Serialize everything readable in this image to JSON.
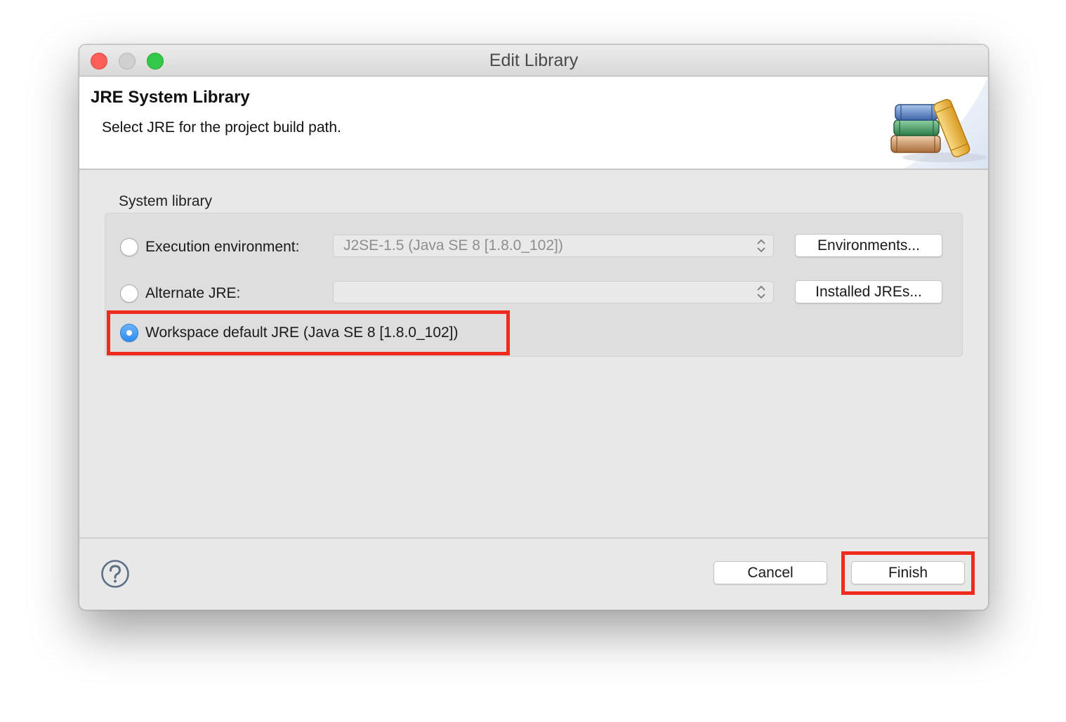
{
  "window": {
    "title": "Edit Library"
  },
  "header": {
    "title": "JRE System Library",
    "description": "Select JRE for the project build path.",
    "banner_icon": "library-books-icon"
  },
  "system_library": {
    "group_label": "System library",
    "execution_environment": {
      "label": "Execution environment:",
      "value": "J2SE-1.5 (Java SE 8 [1.8.0_102])",
      "selected": false,
      "button_label": "Environments..."
    },
    "alternate_jre": {
      "label": "Alternate JRE:",
      "value": "",
      "selected": false,
      "button_label": "Installed JREs..."
    },
    "workspace_default": {
      "label": "Workspace default JRE (Java SE 8 [1.8.0_102])",
      "selected": true
    }
  },
  "footer": {
    "help_icon": "help-icon",
    "cancel_label": "Cancel",
    "finish_label": "Finish"
  },
  "colors": {
    "highlight": "#ef2b20",
    "radio_selected": "#2f8cf0",
    "close": "#fc5f57",
    "zoom": "#34c84a"
  }
}
